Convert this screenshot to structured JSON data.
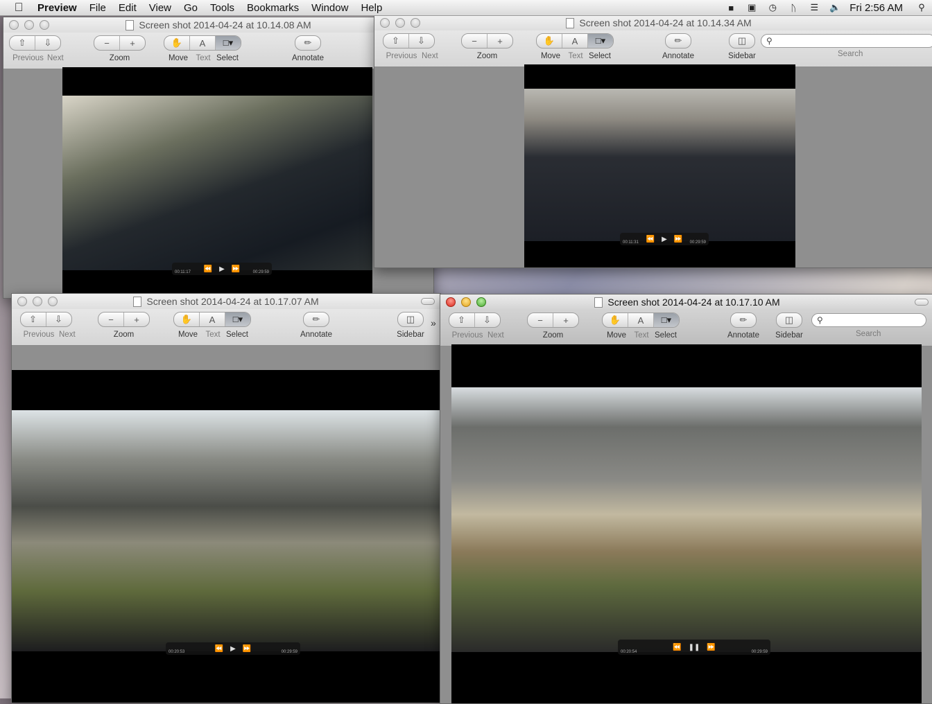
{
  "menubar": {
    "app": "Preview",
    "items": [
      "File",
      "Edit",
      "View",
      "Go",
      "Tools",
      "Bookmarks",
      "Window",
      "Help"
    ],
    "clock": "Fri 2:56 AM",
    "status_icons": [
      "finder-icon",
      "display-icon",
      "time-machine-icon",
      "bluetooth-icon",
      "wifi-icon",
      "volume-icon",
      "spotlight-icon"
    ]
  },
  "toolbar_labels": {
    "previous": "Previous",
    "next": "Next",
    "zoom": "Zoom",
    "move": "Move",
    "text": "Text",
    "select": "Select",
    "annotate": "Annotate",
    "sidebar": "Sidebar",
    "search": "Search"
  },
  "windows": [
    {
      "title": "Screen shot 2014-04-24 at 10.14.08 AM",
      "active": false,
      "video": {
        "time_left": "00:11:17",
        "time_right": "00:29:59",
        "state": "paused"
      }
    },
    {
      "title": "Screen shot 2014-04-24 at 10.14.34 AM",
      "active": false,
      "video": {
        "time_left": "00:11:31",
        "time_right": "00:29:59",
        "state": "paused"
      }
    },
    {
      "title": "Screen shot 2014-04-24 at 10.17.07 AM",
      "active": false,
      "video": {
        "time_left": "00:20:53",
        "time_right": "00:29:59",
        "state": "paused"
      }
    },
    {
      "title": "Screen shot 2014-04-24 at 10.17.10 AM",
      "active": true,
      "video": {
        "time_left": "00:20:54",
        "time_right": "00:29:59",
        "state": "playing"
      }
    }
  ],
  "colors": {
    "accent_select": "#9aa0a8"
  }
}
